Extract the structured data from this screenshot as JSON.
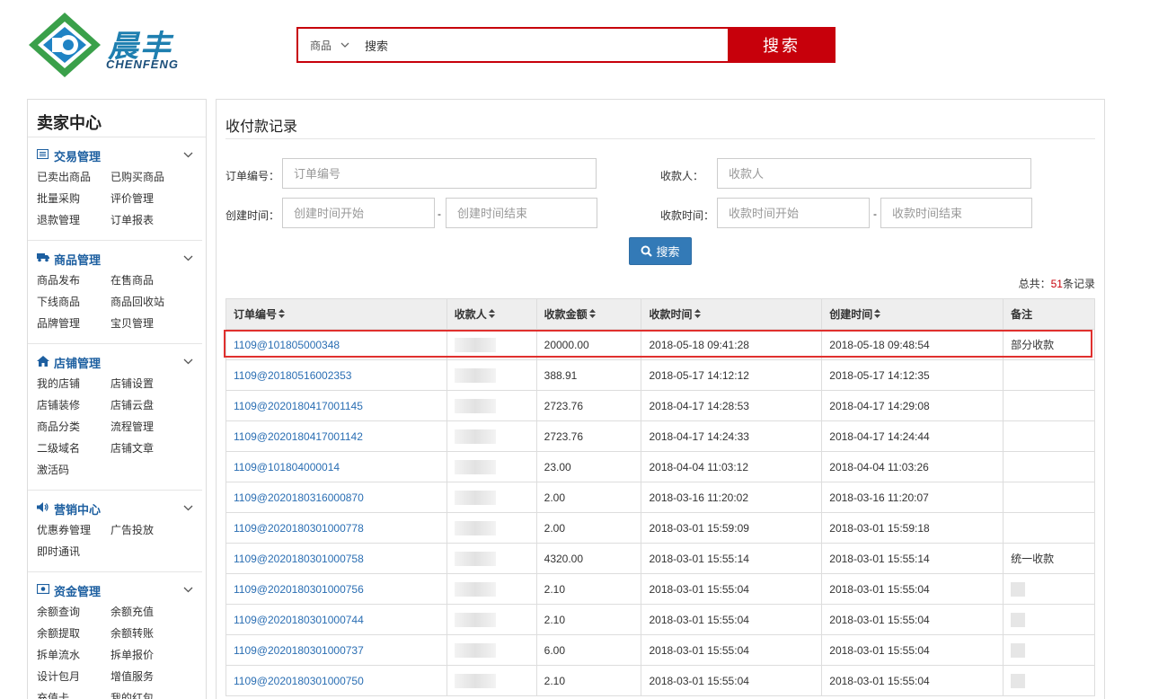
{
  "header": {
    "logo_cn": "晨丰",
    "logo_en": "CHENFENG",
    "search_category": "商品",
    "search_value": "搜索",
    "search_button": "搜索",
    "brand_red": "#c7000b"
  },
  "sidebar": {
    "title": "卖家中心",
    "sections": [
      {
        "icon": "list-icon",
        "title": "交易管理",
        "items": [
          "已卖出商品",
          "已购买商品",
          "批量采购",
          "评价管理",
          "退款管理",
          "订单报表"
        ]
      },
      {
        "icon": "truck-icon",
        "title": "商品管理",
        "items": [
          "商品发布",
          "在售商品",
          "下线商品",
          "商品回收站",
          "品牌管理",
          "宝贝管理"
        ]
      },
      {
        "icon": "home-icon",
        "title": "店铺管理",
        "items": [
          "我的店铺",
          "店铺设置",
          "店铺装修",
          "店铺云盘",
          "商品分类",
          "流程管理",
          "二级域名",
          "店铺文章",
          "激活码"
        ]
      },
      {
        "icon": "volume-icon",
        "title": "营销中心",
        "items": [
          "优惠券管理",
          "广告投放",
          "即时通讯"
        ]
      },
      {
        "icon": "money-icon",
        "title": "资金管理",
        "items": [
          "余额查询",
          "余额充值",
          "余额提取",
          "余额转账",
          "拆单流水",
          "拆单报价",
          "设计包月",
          "增值服务",
          "充值卡",
          "我的红包"
        ]
      }
    ]
  },
  "main": {
    "title": "收付款记录",
    "filters": {
      "order_no_label": "订单编号：",
      "order_no_placeholder": "订单编号",
      "payee_label": "收款人：",
      "payee_placeholder": "收款人",
      "created_label": "创建时间：",
      "created_start_placeholder": "创建时间开始",
      "created_end_placeholder": "创建时间结束",
      "received_label": "收款时间：",
      "received_start_placeholder": "收款时间开始",
      "received_end_placeholder": "收款时间结束",
      "dash": "-",
      "query_button": "搜索"
    },
    "total_prefix": "总共：",
    "total_count": "51",
    "total_suffix": "条记录",
    "table": {
      "headers": [
        "订单编号",
        "收款人",
        "收款金额",
        "收款时间",
        "创建时间",
        "备注"
      ],
      "rows": [
        {
          "order": "1109@101805000348",
          "amount": "20000.00",
          "received": "2018-05-18 09:41:28",
          "created": "2018-05-18 09:48:54",
          "note": "部分收款",
          "note_blur": false
        },
        {
          "order": "1109@20180516002353",
          "amount": "388.91",
          "received": "2018-05-17 14:12:12",
          "created": "2018-05-17 14:12:35",
          "note": "",
          "note_blur": false
        },
        {
          "order": "1109@2020180417001145",
          "amount": "2723.76",
          "received": "2018-04-17 14:28:53",
          "created": "2018-04-17 14:29:08",
          "note": "",
          "note_blur": false
        },
        {
          "order": "1109@2020180417001142",
          "amount": "2723.76",
          "received": "2018-04-17 14:24:33",
          "created": "2018-04-17 14:24:44",
          "note": "",
          "note_blur": false
        },
        {
          "order": "1109@101804000014",
          "amount": "23.00",
          "received": "2018-04-04 11:03:12",
          "created": "2018-04-04 11:03:26",
          "note": "",
          "note_blur": false
        },
        {
          "order": "1109@2020180316000870",
          "amount": "2.00",
          "received": "2018-03-16 11:20:02",
          "created": "2018-03-16 11:20:07",
          "note": "",
          "note_blur": false
        },
        {
          "order": "1109@2020180301000778",
          "amount": "2.00",
          "received": "2018-03-01 15:59:09",
          "created": "2018-03-01 15:59:18",
          "note": "",
          "note_blur": false
        },
        {
          "order": "1109@2020180301000758",
          "amount": "4320.00",
          "received": "2018-03-01 15:55:14",
          "created": "2018-03-01 15:55:14",
          "note": "统一收款",
          "note_blur": false
        },
        {
          "order": "1109@2020180301000756",
          "amount": "2.10",
          "received": "2018-03-01 15:55:04",
          "created": "2018-03-01 15:55:04",
          "note": "",
          "note_blur": true
        },
        {
          "order": "1109@2020180301000744",
          "amount": "2.10",
          "received": "2018-03-01 15:55:04",
          "created": "2018-03-01 15:55:04",
          "note": "",
          "note_blur": true
        },
        {
          "order": "1109@2020180301000737",
          "amount": "6.00",
          "received": "2018-03-01 15:55:04",
          "created": "2018-03-01 15:55:04",
          "note": "",
          "note_blur": true
        },
        {
          "order": "1109@2020180301000750",
          "amount": "2.10",
          "received": "2018-03-01 15:55:04",
          "created": "2018-03-01 15:55:04",
          "note": "",
          "note_blur": true
        }
      ]
    }
  }
}
